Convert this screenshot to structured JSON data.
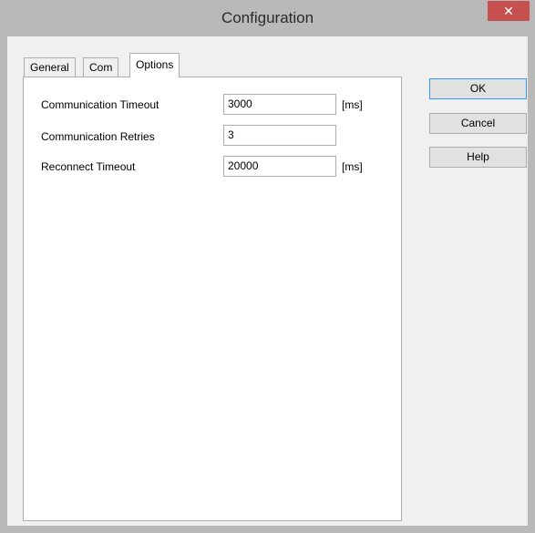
{
  "window": {
    "title": "Configuration",
    "close_glyph": "✕"
  },
  "tabs": [
    {
      "label": "General",
      "active": false
    },
    {
      "label": "Com",
      "active": false
    },
    {
      "label": "Options",
      "active": true
    }
  ],
  "options": {
    "rows": [
      {
        "label": "Communication Timeout",
        "value": "3000",
        "unit": "[ms]"
      },
      {
        "label": "Communication Retries",
        "value": "3",
        "unit": ""
      },
      {
        "label": "Reconnect Timeout",
        "value": "20000",
        "unit": "[ms]"
      }
    ]
  },
  "buttons": {
    "ok": "OK",
    "cancel": "Cancel",
    "help": "Help"
  }
}
